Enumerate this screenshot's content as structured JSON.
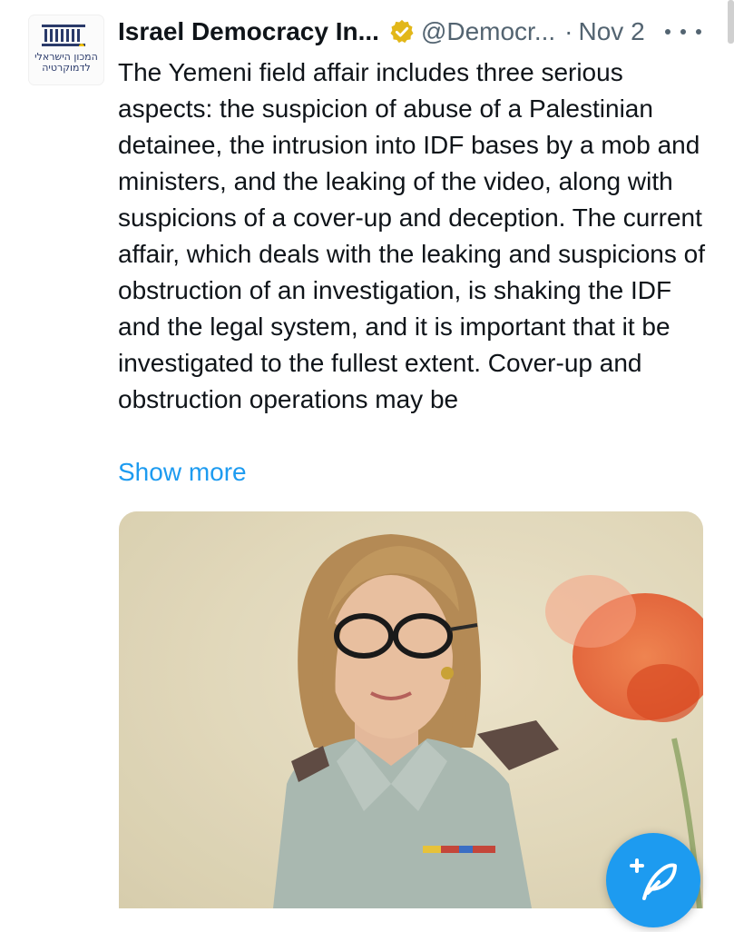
{
  "tweet": {
    "author_name": "Israel Democracy In...",
    "handle": "@Democr...",
    "separator": "·",
    "date": "Nov 2",
    "text": "The Yemeni field affair includes three serious aspects: the suspicion of abuse of a Palestinian detainee, the intrusion into IDF bases by a mob and ministers, and the leaking of the video, along with suspicions of a cover-up and deception. The current affair, which deals with the leaking and suspicions of obstruction of an investigation, is shaking the IDF and the legal system, and it is important that it be investigated to the fullest extent. Cover-up and obstruction operations may be",
    "show_more": "Show more"
  },
  "avatar": {
    "logo_line1": "המכון הישראלי",
    "logo_line2": "לדמוקרטיה"
  },
  "icons": {
    "verified": "verified-badge-icon",
    "more": "more-options-icon",
    "compose": "compose-post-icon"
  },
  "colors": {
    "text": "#0f1419",
    "secondary": "#536471",
    "link": "#1d9bf0",
    "verified": "#e2b719",
    "fab": "#1d9bf0"
  }
}
